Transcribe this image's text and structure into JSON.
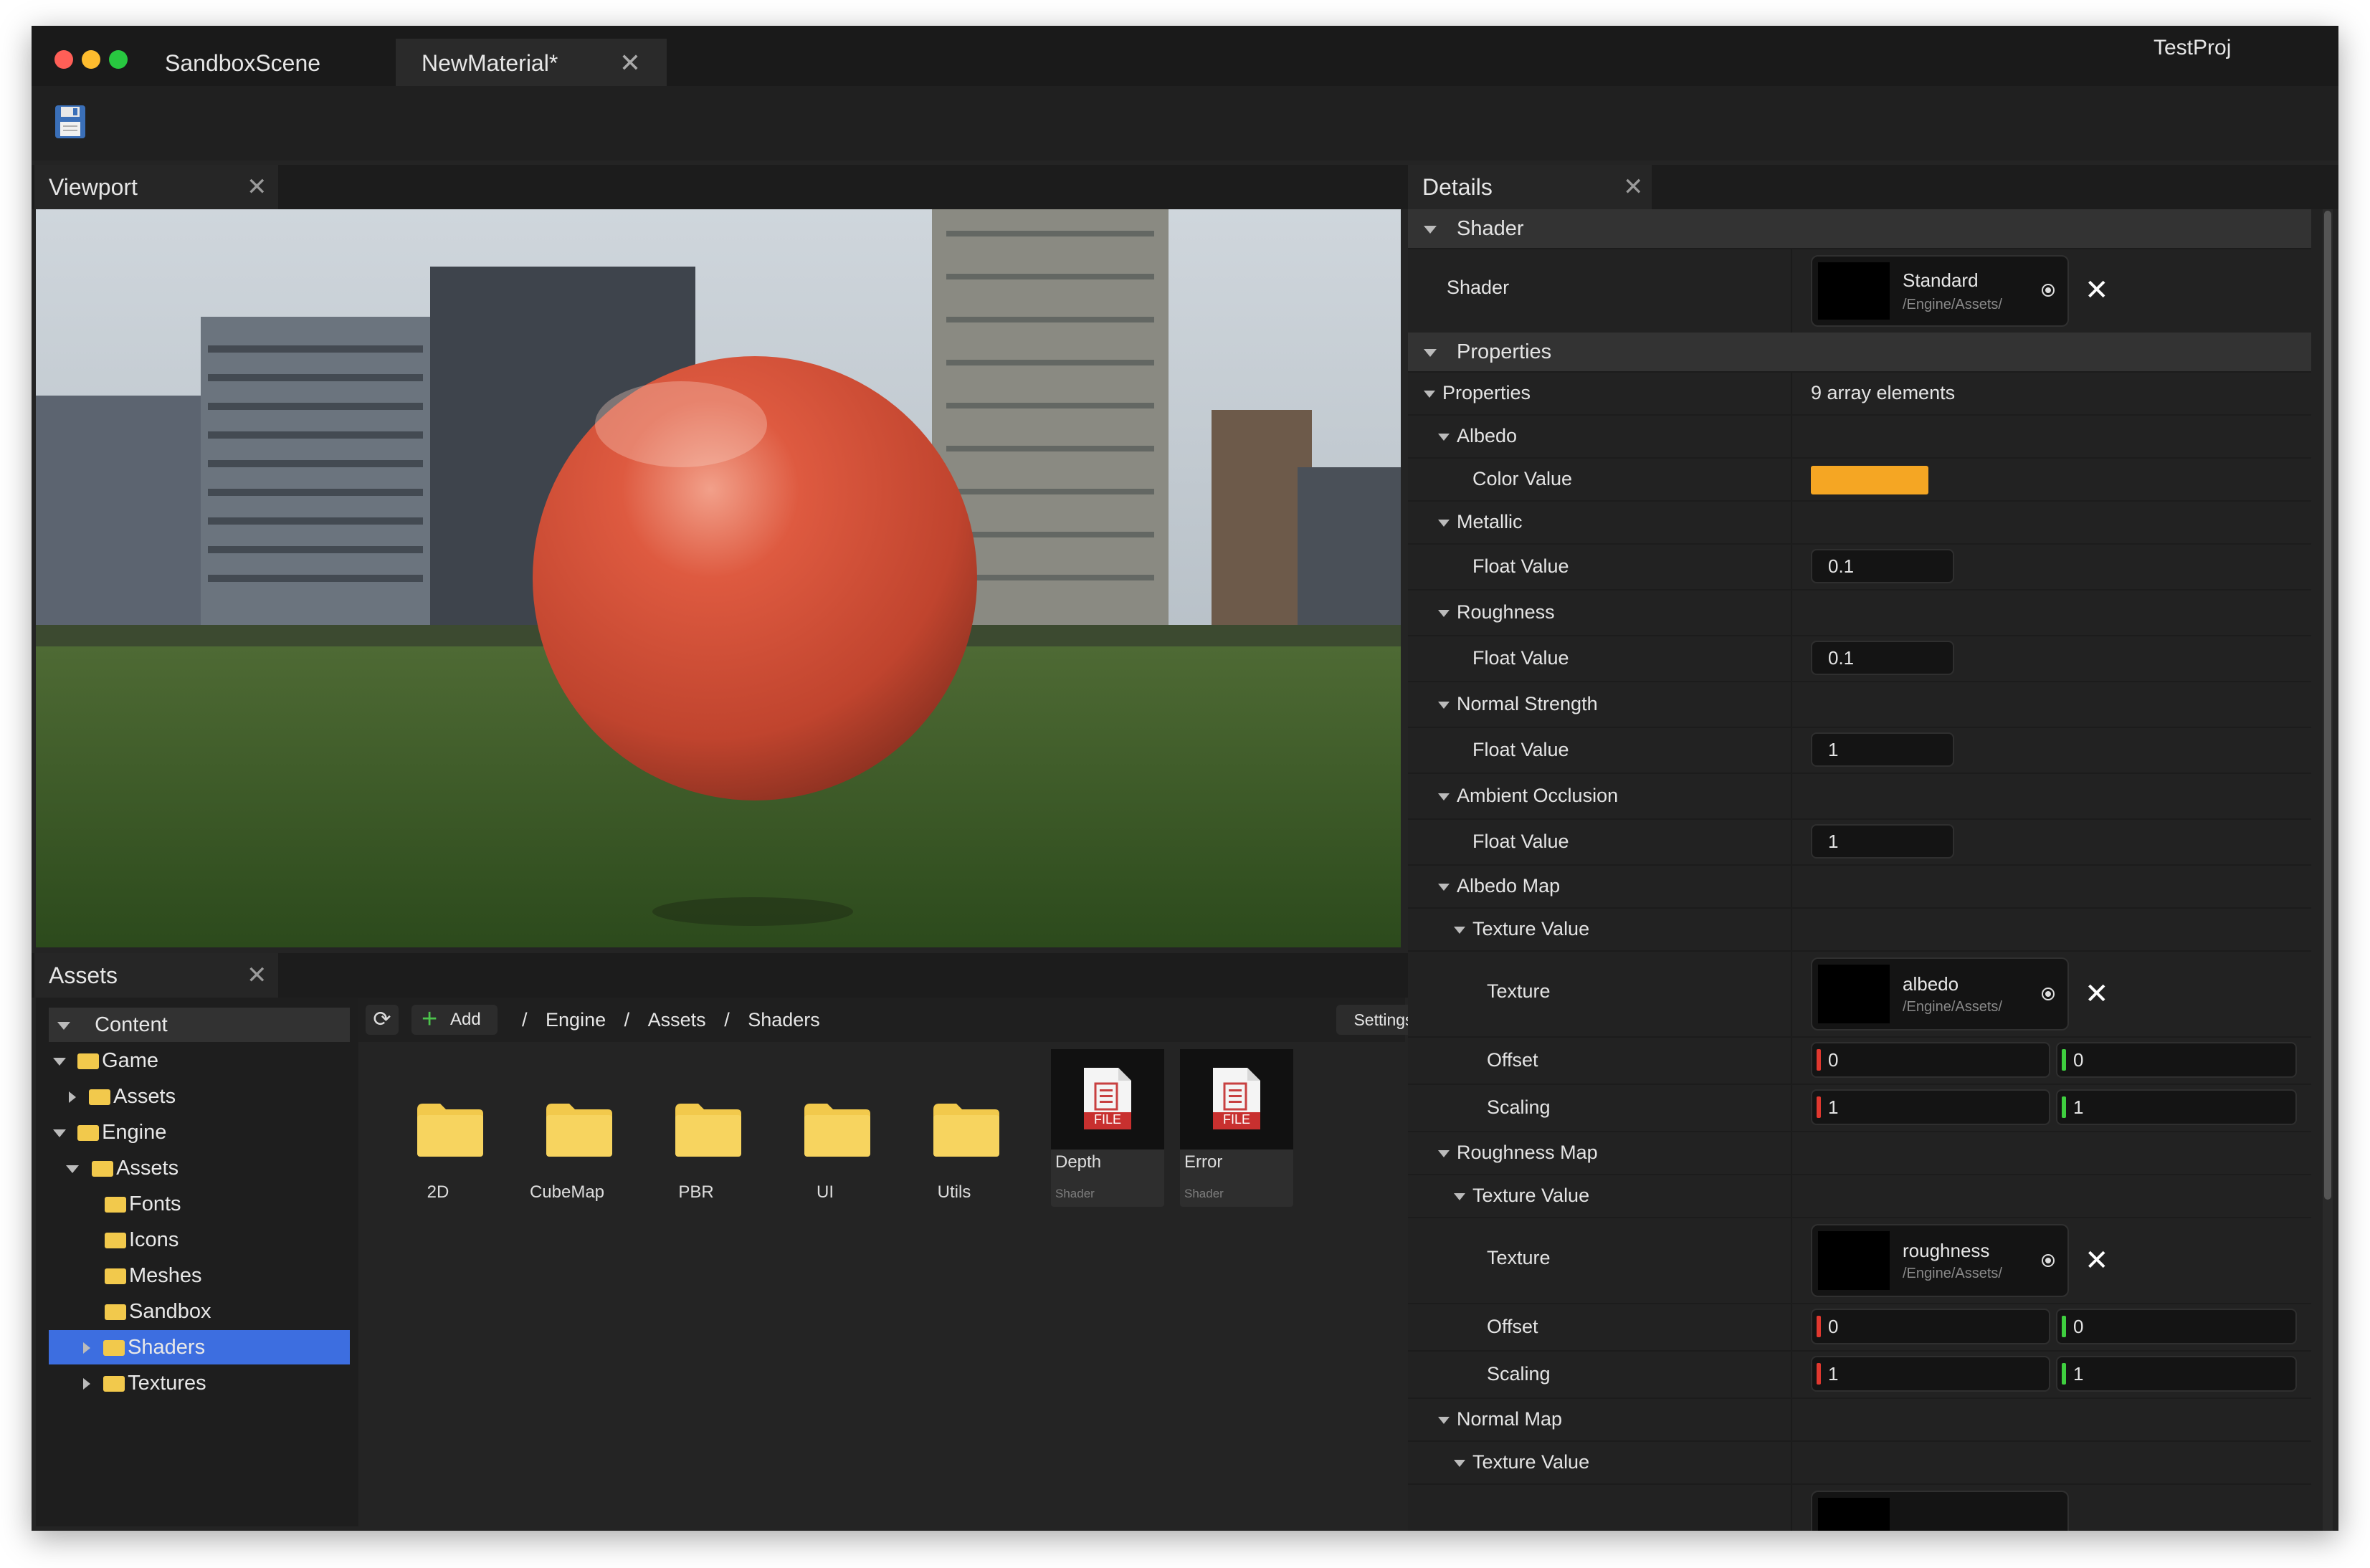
{
  "window": {
    "tabs": [
      {
        "label": "SandboxScene"
      },
      {
        "label": "NewMaterial*"
      }
    ],
    "project": "TestProj"
  },
  "toolbar": {
    "save_icon": "floppy-disk-icon"
  },
  "viewport": {
    "tab_label": "Viewport"
  },
  "assets_panel": {
    "tab_label": "Assets",
    "tree": [
      {
        "label": "Content"
      },
      {
        "label": "Game"
      },
      {
        "label": "Assets"
      },
      {
        "label": "Engine"
      },
      {
        "label": "Assets"
      },
      {
        "label": "Fonts"
      },
      {
        "label": "Icons"
      },
      {
        "label": "Meshes"
      },
      {
        "label": "Sandbox"
      },
      {
        "label": "Shaders"
      },
      {
        "label": "Textures"
      }
    ],
    "add_label": "Add",
    "settings_label": "Settings",
    "breadcrumb": [
      "Engine",
      "Assets",
      "Shaders"
    ],
    "breadcrumb_sep": "/",
    "items": [
      {
        "label": "2D"
      },
      {
        "label": "CubeMap"
      },
      {
        "label": "PBR"
      },
      {
        "label": "UI"
      },
      {
        "label": "Utils"
      },
      {
        "label": "Depth",
        "type": "Shader",
        "badge": "FILE"
      },
      {
        "label": "Error",
        "type": "Shader",
        "badge": "FILE"
      }
    ]
  },
  "details": {
    "tab_label": "Details",
    "shader_section": "Shader",
    "shader_label": "Shader",
    "shader_name": "Standard",
    "shader_path": "/Engine/Assets/",
    "properties_section": "Properties",
    "properties_label": "Properties",
    "properties_count": "9 array elements",
    "albedo": "Albedo",
    "color_value_label": "Color Value",
    "color_value": "#f5a623",
    "metallic": "Metallic",
    "float_label": "Float Value",
    "metallic_value": "0.1",
    "roughness": "Roughness",
    "roughness_value": "0.1",
    "normal_strength": "Normal Strength",
    "normal_value": "1",
    "ambient_occlusion": "Ambient Occlusion",
    "ao_value": "1",
    "albedo_map": "Albedo Map",
    "texture_value_label": "Texture Value",
    "texture_label": "Texture",
    "albedo_tex_name": "albedo",
    "tex_path": "/Engine/Assets/",
    "offset_label": "Offset",
    "scaling_label": "Scaling",
    "zero": "0",
    "one": "1",
    "roughness_map": "Roughness Map",
    "roughness_tex_name": "roughness",
    "normal_map": "Normal Map"
  },
  "colors": {
    "accent_selection": "#3d6ee0",
    "folder": "#f2c94c",
    "x_axis": "#e0382f",
    "y_axis": "#3fcf3f",
    "albedo": "#f5a623"
  }
}
